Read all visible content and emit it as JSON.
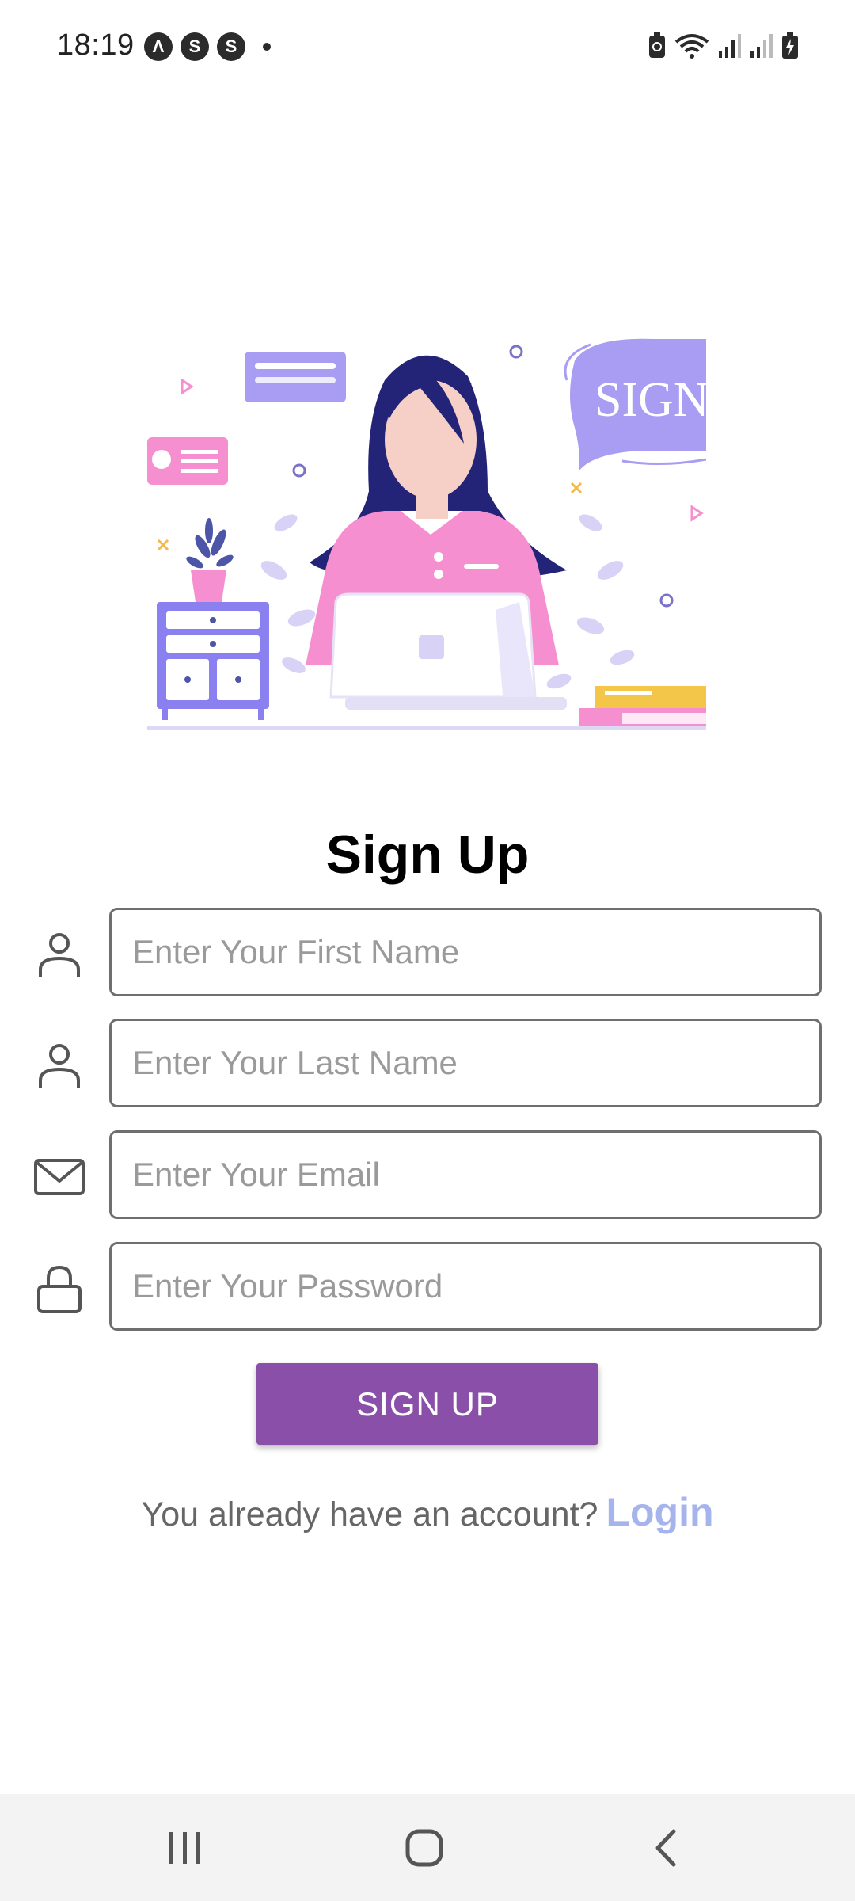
{
  "status_bar": {
    "time": "18:19",
    "notifications": [
      {
        "icon": "app-a-icon",
        "glyph": "Λ"
      },
      {
        "icon": "app-s-icon",
        "glyph": "S"
      },
      {
        "icon": "app-s-icon",
        "glyph": "S"
      }
    ],
    "right_icons": [
      "battery-saver-icon",
      "wifi-icon",
      "signal-icon",
      "signal-icon",
      "battery-charging-icon"
    ]
  },
  "hero": {
    "speech_bubble_text": "SIGN U"
  },
  "page": {
    "title": "Sign Up"
  },
  "form": {
    "first_name": {
      "icon": "person-icon",
      "placeholder": "Enter Your First Name",
      "value": ""
    },
    "last_name": {
      "icon": "person-icon",
      "placeholder": "Enter Your Last Name",
      "value": ""
    },
    "email": {
      "icon": "mail-icon",
      "placeholder": "Enter Your Email",
      "value": ""
    },
    "password": {
      "icon": "lock-icon",
      "placeholder": "Enter Your Password",
      "value": ""
    }
  },
  "actions": {
    "signup_label": "SIGN UP",
    "login_prompt": "You already have an account?",
    "login_label": "Login"
  },
  "colors": {
    "primary_button": "#8a4fa8",
    "login_link": "#a6b4ee",
    "input_border": "#6f6f6f",
    "placeholder": "#9a9a9a"
  },
  "nav_bar": {
    "buttons": [
      "recent-apps-icon",
      "home-icon",
      "back-icon"
    ]
  }
}
